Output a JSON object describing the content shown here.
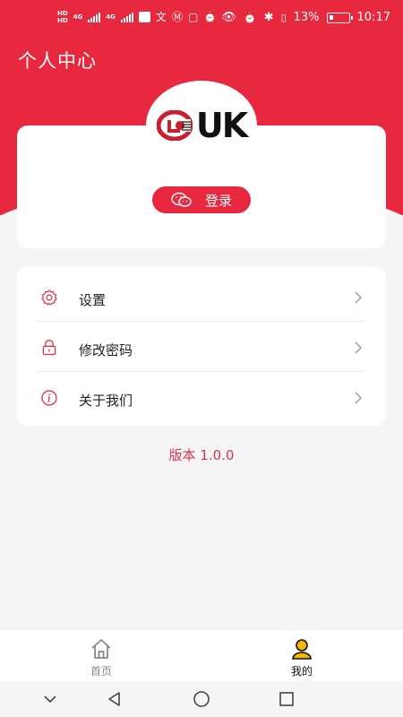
{
  "status_bar": {
    "network_labels": [
      "HD",
      "HD",
      "4G",
      "4G"
    ],
    "battery_percent": "13%",
    "time": "10:17"
  },
  "header": {
    "title": "个人中心"
  },
  "profile": {
    "logo_text": "UK",
    "login_label": "登录"
  },
  "menu": {
    "items": [
      {
        "label": "设置",
        "icon": "gear-icon"
      },
      {
        "label": "修改密码",
        "icon": "lock-icon"
      },
      {
        "label": "关于我们",
        "icon": "info-icon"
      }
    ]
  },
  "version": "版本 1.0.0",
  "tabbar": {
    "tabs": [
      {
        "label": "首页",
        "icon": "home-icon",
        "active": false
      },
      {
        "label": "我的",
        "icon": "user-icon",
        "active": true
      }
    ]
  },
  "colors": {
    "accent": "#e8283f",
    "background": "#f5f5f5",
    "version_text": "#d43650"
  }
}
